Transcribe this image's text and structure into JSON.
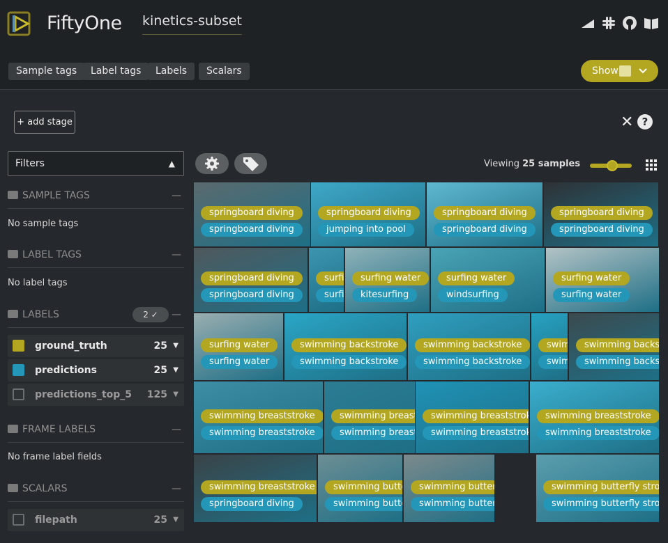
{
  "app": {
    "name": "FiftyOne",
    "dataset": "kinetics-subset"
  },
  "tabs": [
    "Sample tags",
    "Label tags",
    "Labels",
    "Scalars"
  ],
  "show_button": "Show",
  "add_stage": "+ add stage",
  "sidebar": {
    "filters_label": "Filters",
    "sample_tags": {
      "title": "SAMPLE TAGS",
      "empty": "No sample tags"
    },
    "label_tags": {
      "title": "LABEL TAGS",
      "empty": "No label tags"
    },
    "labels": {
      "title": "LABELS",
      "active_count": "2 ✓",
      "fields": [
        {
          "name": "ground_truth",
          "count": "25",
          "checked": true,
          "color": "#b3a722"
        },
        {
          "name": "predictions",
          "count": "25",
          "checked": true,
          "color": "#2497b8"
        },
        {
          "name": "predictions_top_5",
          "count": "125",
          "checked": false,
          "color": "#6b6e71"
        }
      ]
    },
    "frame_labels": {
      "title": "FRAME LABELS",
      "empty": "No frame label fields"
    },
    "scalars": {
      "title": "SCALARS",
      "fields": [
        {
          "name": "filepath",
          "count": "25"
        }
      ]
    }
  },
  "grid": {
    "viewing_prefix": "Viewing ",
    "viewing_count": "25 samples",
    "tiles": [
      {
        "gt": "springboard diving",
        "pred": "springboard diving",
        "bg": "#5b6a6e"
      },
      {
        "gt": "springboard diving",
        "pred": "jumping into pool",
        "bg": "#3fa8c8"
      },
      {
        "gt": "springboard diving",
        "pred": "springboard diving",
        "bg": "#5fb8d0"
      },
      {
        "gt": "springboard diving",
        "pred": "springboard diving",
        "bg": "#2e3236"
      },
      {
        "gt": "springboard diving",
        "pred": "springboard diving",
        "bg": "#50585c"
      },
      {
        "gt": "surfing water",
        "pred": "surfing water",
        "bg": "#3c95b0"
      },
      {
        "gt": "surfing water",
        "pred": "kitesurfing",
        "bg": "#8fb2b8"
      },
      {
        "gt": "surfing water",
        "pred": "windsurfing",
        "bg": "#4aa3b5"
      },
      {
        "gt": "surfing water",
        "pred": "surfing water",
        "bg": "#b3c3c5"
      },
      {
        "gt": "surfing water",
        "pred": "surfing water",
        "bg": "#9aaeb0"
      },
      {
        "gt": "swimming backstroke",
        "pred": "swimming backstroke",
        "bg": "#2aa6c6"
      },
      {
        "gt": "swimming backstroke",
        "pred": "swimming backstroke",
        "bg": "#2f9fbf"
      },
      {
        "gt": "swimming backstroke",
        "pred": "swimming backstroke",
        "bg": "#27a2c2"
      },
      {
        "gt": "swimming backstroke",
        "pred": "swimming backstroke",
        "bg": "#3b4a4e"
      },
      {
        "gt": "swimming breaststroke",
        "pred": "swimming breaststroke",
        "bg": "#3d8ea4"
      },
      {
        "gt": "swimming breaststroke",
        "pred": "swimming breaststroke",
        "bg": "#2c7d93"
      },
      {
        "gt": "swimming breaststroke",
        "pred": "swimming breaststroke",
        "bg": "#1f92b6"
      },
      {
        "gt": "swimming breaststroke",
        "pred": "swimming breaststroke",
        "bg": "#3aaecd"
      },
      {
        "gt": "swimming breaststroke",
        "pred": "springboard diving",
        "bg": "#3a4347"
      },
      {
        "gt": "swimming butterfly",
        "pred": "swimming butterfly",
        "bg": "#6d8e94"
      },
      {
        "gt": "swimming butterfly",
        "pred": "swimming butterfly",
        "bg": "#7c8a8c"
      },
      {
        "gt": "swimming butterfly stroke",
        "pred": "swimming butterfly stroke",
        "bg": "#5b9eae"
      }
    ]
  }
}
